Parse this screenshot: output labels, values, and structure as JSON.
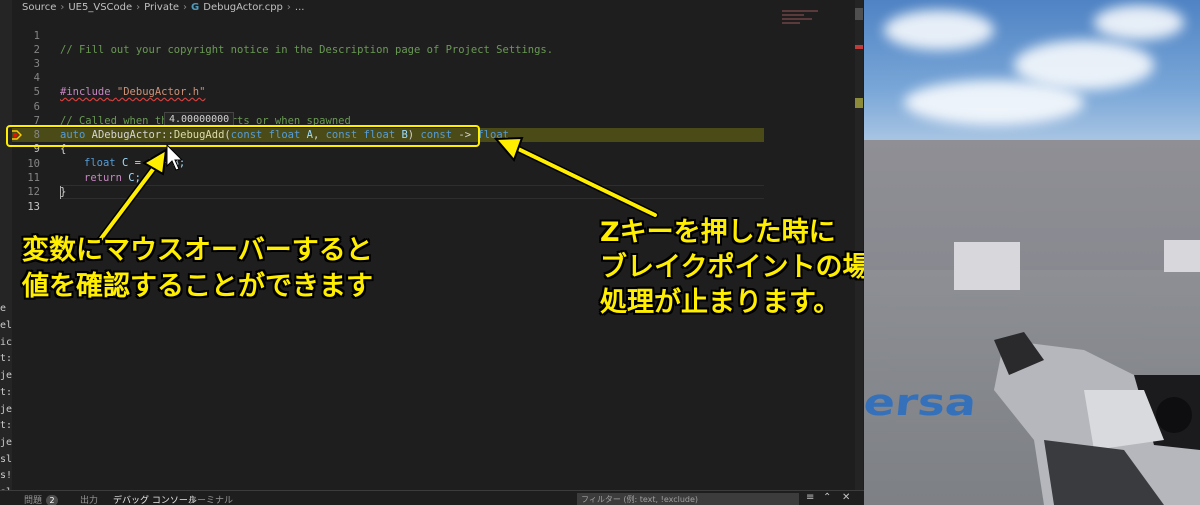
{
  "breadcrumb": {
    "items": [
      "Source",
      "UE5_VSCode",
      "Private"
    ],
    "file_icon": "G",
    "file": "DebugActor.cpp",
    "more": "..."
  },
  "code_lines": {
    "l1": {
      "num": "1",
      "comment": "// Fill out your copyright notice in the Description page of Project Settings."
    },
    "l2": {
      "num": "2"
    },
    "l3": {
      "num": "3"
    },
    "l4": {
      "num": "4",
      "directive": "#include",
      "path": "\"DebugActor.h\""
    },
    "l5": {
      "num": "5"
    },
    "l6": {
      "num": "6",
      "comment": "// Called when the game starts or when spawned"
    },
    "l7": {
      "num": "7",
      "kw_auto": "auto",
      "class_name": "ADebugActor",
      "scope": "::",
      "fn_name": "DebugAdd",
      "paren_open": "(",
      "kw_const1": "const",
      "kw_float1": "float",
      "param_a": "A",
      "comma": ",",
      "kw_const2": "const",
      "kw_float2": "float",
      "param_b": "B",
      "paren_close": ")",
      "kw_const3": "const",
      "arrow": "->",
      "kw_float3": "float"
    },
    "l8": {
      "num": "8",
      "text": "{"
    },
    "l9": {
      "num": "9",
      "kw_float": "float",
      "expr": "C = A + B;"
    },
    "l10": {
      "num": "10",
      "kw_return": "return",
      "expr": "C;"
    },
    "l11": {
      "num": "11",
      "text": "}"
    },
    "l12": {
      "num": "12"
    },
    "l13": {
      "num": "13"
    }
  },
  "hover_value": "4.00000000",
  "panel": {
    "problems": "問題",
    "problems_count": "2",
    "output": "出力",
    "debug_console": "デバッグ コンソール",
    "terminal": "ターミナル",
    "filter_placeholder": "フィルター (例: text, !exclude)"
  },
  "annotations": {
    "left_line1": "変数にマウスオーバーすると",
    "left_line2": "値を確認することができます",
    "right_line1": "Zキーを押した時に",
    "right_line2": "ブレイクポイントの場所で",
    "right_line3": "処理が止まります。"
  },
  "left_strip_chars": [
    "e",
    "el",
    "ic",
    "t:",
    "je",
    "t:",
    "je",
    "t:",
    "je",
    "sl",
    "s!",
    "sl",
    "t:"
  ],
  "game": {
    "floor_text": "ersa"
  },
  "colors": {
    "annotation": "#ffee00",
    "debug_highlight": "#4b4b18",
    "editor_bg": "#1e1e1e"
  }
}
